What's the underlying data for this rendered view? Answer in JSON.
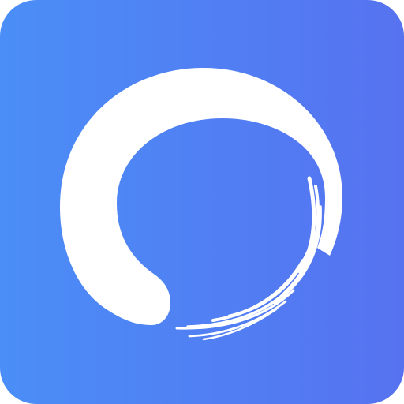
{
  "icon": {
    "name": "enso-circle-icon",
    "gradient_start": "#4b8ef7",
    "gradient_end": "#5672f0",
    "stroke_color": "#ffffff"
  }
}
